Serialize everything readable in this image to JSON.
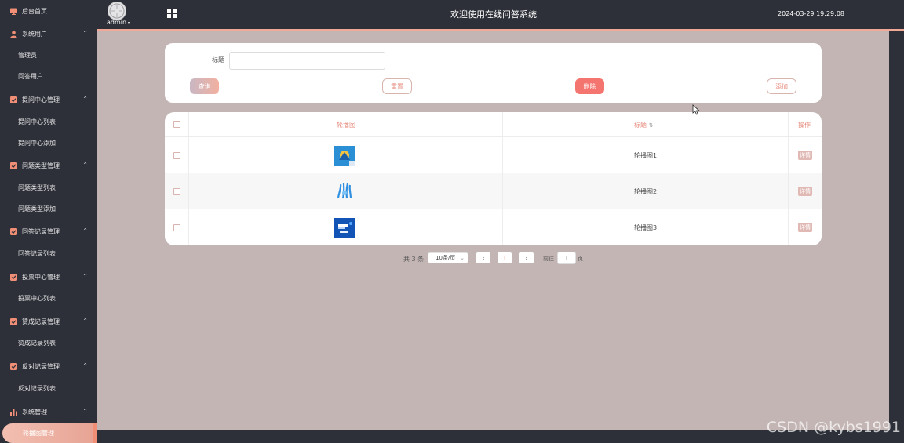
{
  "app": {
    "title": "欢迎使用在线问答系统",
    "datetime": "2024-03-29 19:29:08",
    "user": "admin"
  },
  "sidebar": {
    "home": "后台首页",
    "groups": [
      {
        "label": "系统用户",
        "items": [
          "管理员",
          "问答用户"
        ]
      },
      {
        "label": "提问中心管理",
        "items": [
          "提问中心列表",
          "提问中心添加"
        ]
      },
      {
        "label": "问题类型管理",
        "items": [
          "问题类型列表",
          "问题类型添加"
        ]
      },
      {
        "label": "回答记录管理",
        "items": [
          "回答记录列表"
        ]
      },
      {
        "label": "投票中心管理",
        "items": [
          "投票中心列表"
        ]
      },
      {
        "label": "赞成记录管理",
        "items": [
          "赞成记录列表"
        ]
      },
      {
        "label": "反对记录管理",
        "items": [
          "反对记录列表"
        ]
      },
      {
        "label": "系统管理",
        "items": [
          "轮播图管理"
        ]
      }
    ],
    "active_item": "轮播图管理"
  },
  "search": {
    "title_label": "标题",
    "title_value": "",
    "query": "查询",
    "reset": "重置",
    "delete": "删除",
    "add": "添加"
  },
  "table": {
    "headers": {
      "image": "轮播图",
      "title": "标题",
      "actions": "操作"
    },
    "rows": [
      {
        "title": "轮播图1",
        "action": "详情"
      },
      {
        "title": "轮播图2",
        "action": "详情"
      },
      {
        "title": "轮播图3",
        "action": "详情"
      }
    ]
  },
  "pagination": {
    "total": "共 3 条",
    "page_size": "10条/页",
    "current_page": "1",
    "goto_label": "前往",
    "goto_value": "1",
    "page_suffix": "页",
    "prev": "‹",
    "next": "›"
  },
  "watermark": "CSDN @kybs1991",
  "colors": {
    "sidebar_bg": "#2d3038",
    "main_bg": "#c3b5b4",
    "accent": "#f08e76",
    "delete": "#f4746f"
  }
}
